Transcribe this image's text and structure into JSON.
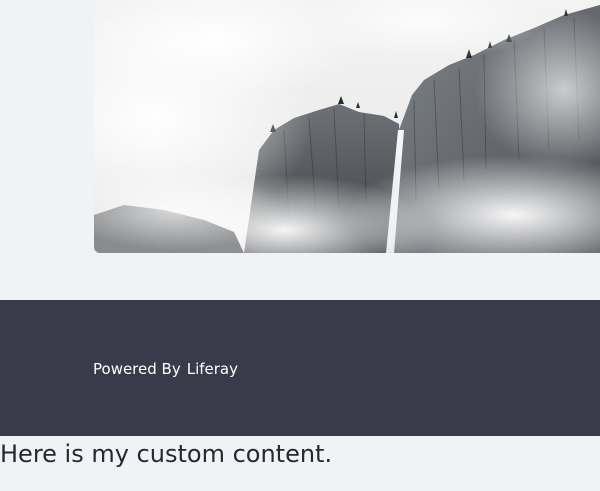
{
  "hero": {
    "image_alt": "Misty mountain cliffs with a waterfall"
  },
  "footer": {
    "powered_by": "Powered By",
    "brand": "Liferay",
    "background_color": "#393a4a"
  },
  "content": {
    "custom_text": "Here is my custom content."
  }
}
